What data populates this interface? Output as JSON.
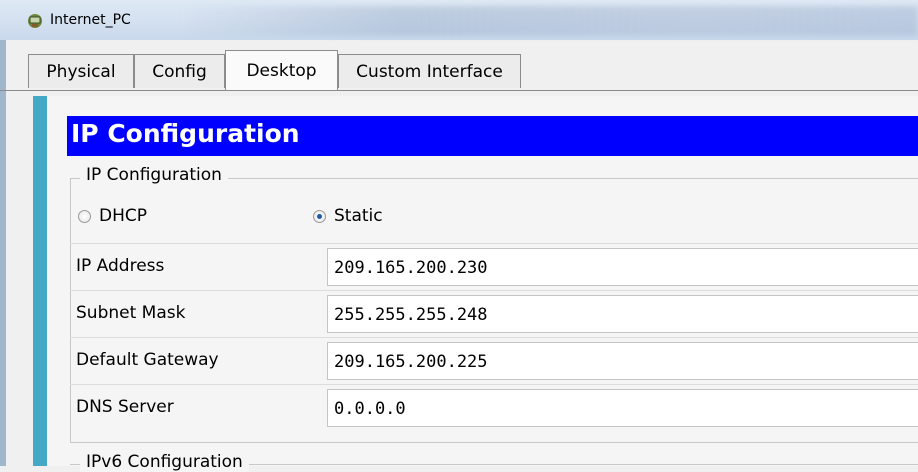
{
  "window": {
    "title": "Internet_PC",
    "icon": "pc-icon"
  },
  "tabs": [
    {
      "label": "Physical",
      "active": false
    },
    {
      "label": "Config",
      "active": false
    },
    {
      "label": "Desktop",
      "active": true
    },
    {
      "label": "Custom Interface",
      "active": false
    }
  ],
  "ip_config": {
    "header": "IP Configuration",
    "group_label": "IP Configuration",
    "dhcp_label": "DHCP",
    "static_label": "Static",
    "selected_mode": "Static",
    "fields": [
      {
        "label": "IP Address",
        "value": "209.165.200.230"
      },
      {
        "label": "Subnet Mask",
        "value": "255.255.255.248"
      },
      {
        "label": "Default Gateway",
        "value": "209.165.200.225"
      },
      {
        "label": "DNS Server",
        "value": "0.0.0.0"
      }
    ],
    "ipv6_label": "IPv6 Configuration"
  },
  "colors": {
    "header_bg": "#0000ff",
    "header_text": "#ffffff",
    "frame": "#43a9c6"
  }
}
